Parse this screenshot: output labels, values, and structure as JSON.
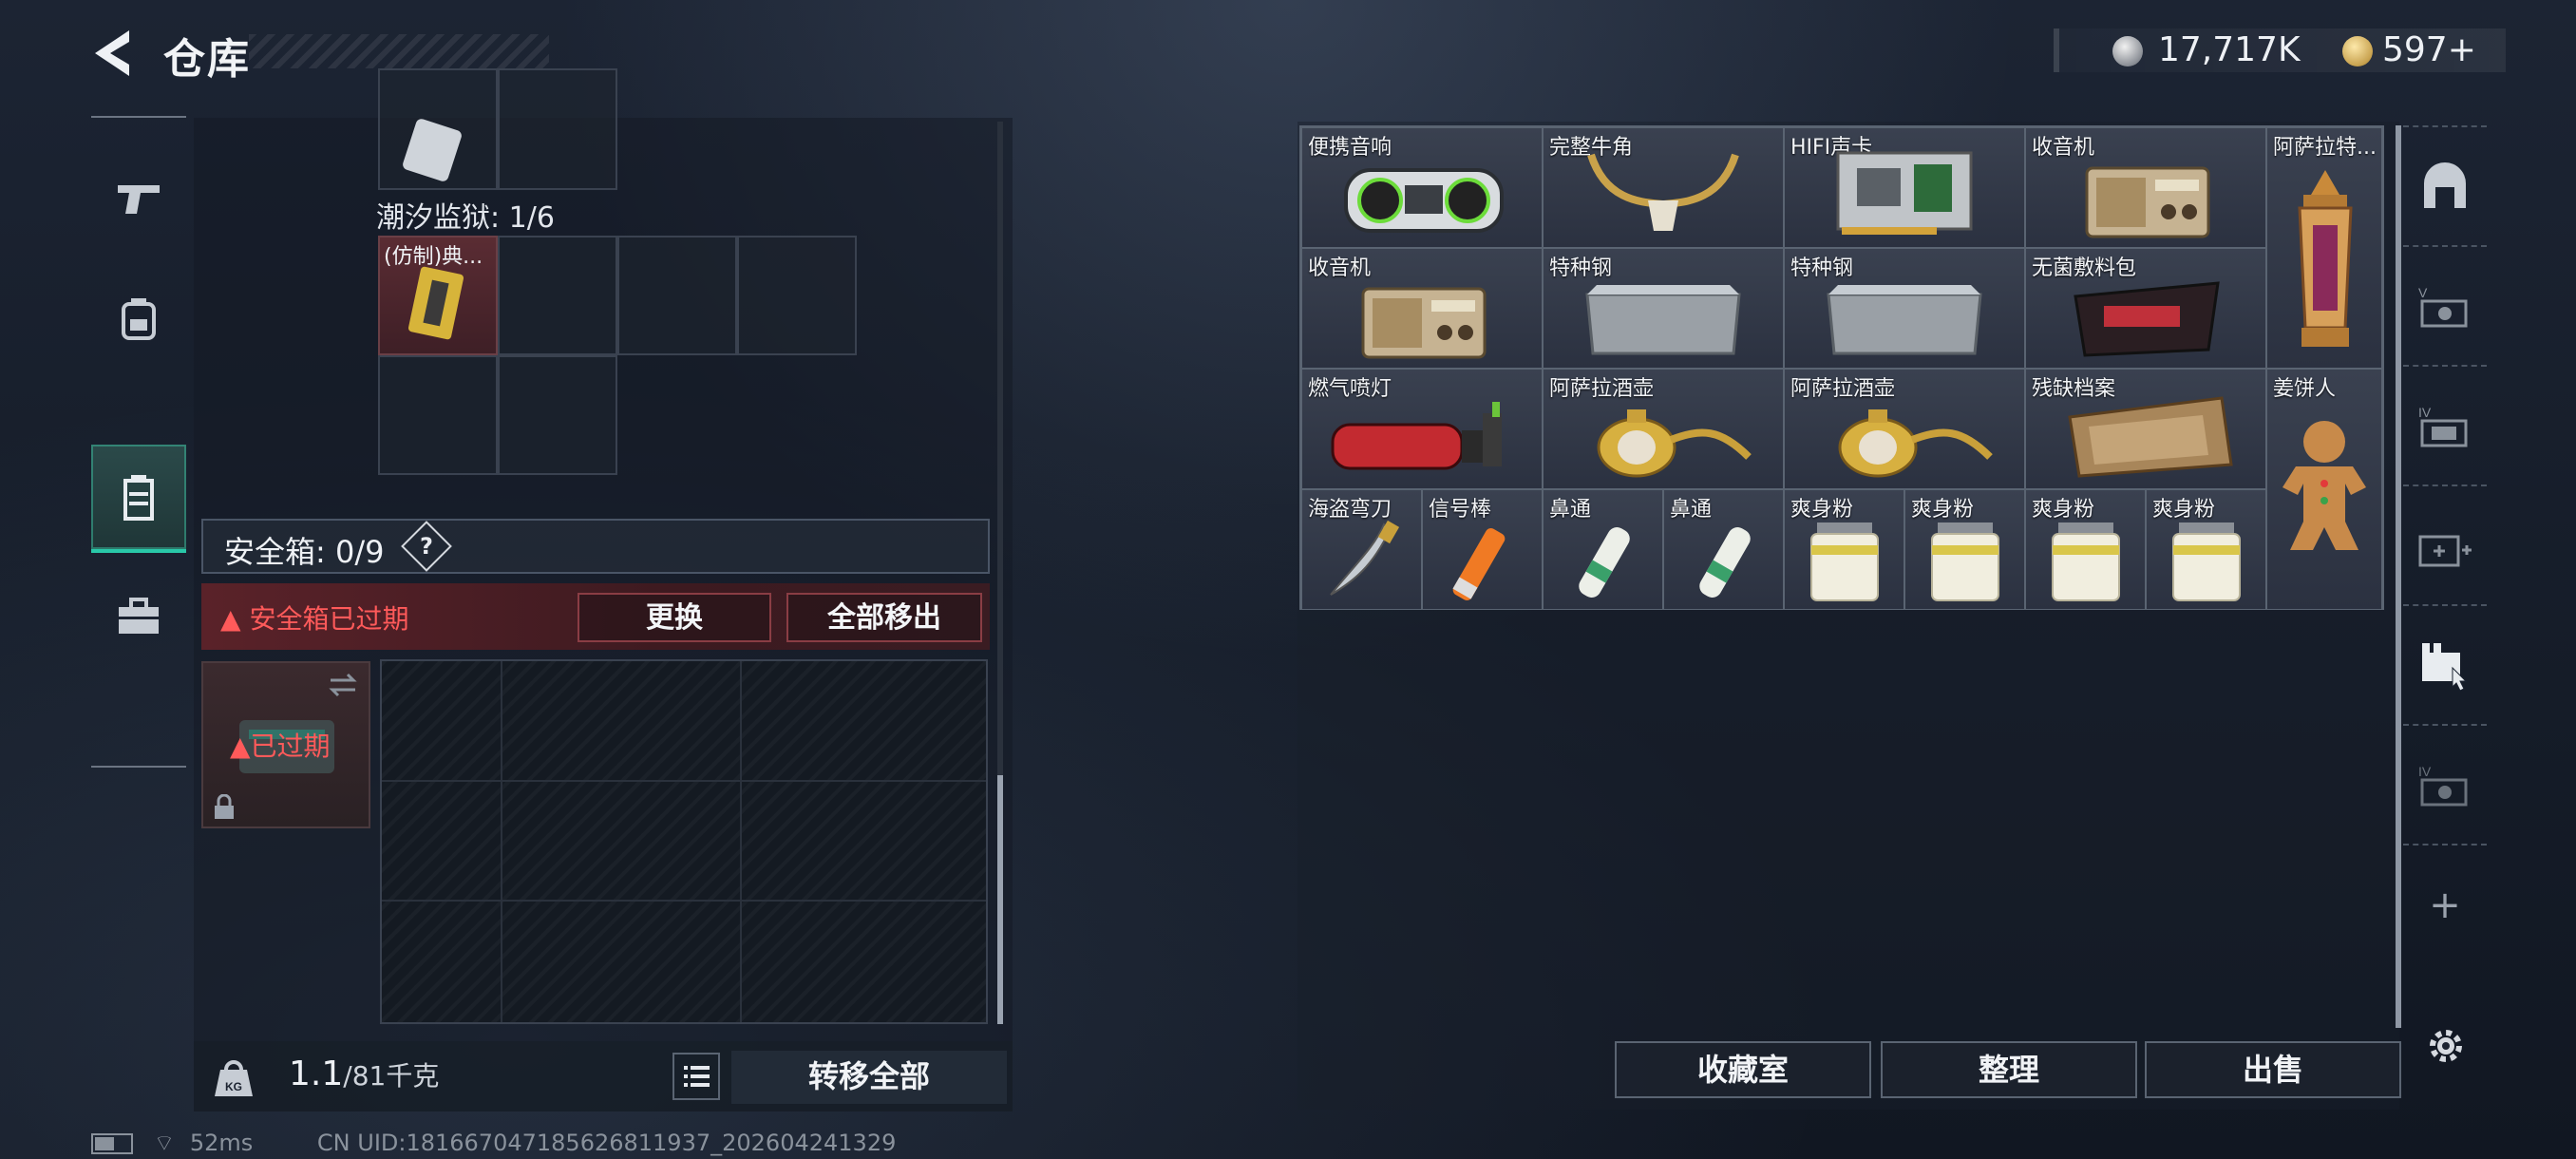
{
  "header": {
    "title": "仓库",
    "silver_amount": "17,717K",
    "gold_amount": "597+"
  },
  "left_rail": {
    "tabs": [
      {
        "name": "gun-icon"
      },
      {
        "name": "backpack-icon"
      },
      {
        "name": "vest-icon",
        "active": true
      },
      {
        "name": "case-icon"
      }
    ]
  },
  "loadout": {
    "container_label": "潮汐监狱: 1/6",
    "item_name": "(仿制)典..."
  },
  "secure_box": {
    "label": "安全箱: 0/9",
    "help": "?",
    "expired_warning": "安全箱已过期",
    "replace_button": "更换",
    "move_all_button": "全部移出",
    "expired_tag": "已过期"
  },
  "weight": {
    "current": "1.1",
    "max": "/81千克",
    "transfer_all": "转移全部"
  },
  "status": {
    "ping": "52ms",
    "uid": "CN UID:181667047185626811937_202604241329"
  },
  "stash": {
    "items": [
      {
        "label": "便携音响"
      },
      {
        "label": "完整牛角"
      },
      {
        "label": "HIFI声卡"
      },
      {
        "label": "收音机"
      },
      {
        "label": "阿萨拉特..."
      },
      {
        "label": "收音机"
      },
      {
        "label": "特种钢"
      },
      {
        "label": "特种钢"
      },
      {
        "label": "无菌敷料包"
      },
      {
        "label": "燃气喷灯"
      },
      {
        "label": "阿萨拉酒壶"
      },
      {
        "label": "阿萨拉酒壶"
      },
      {
        "label": "残缺档案"
      },
      {
        "label": "姜饼人"
      },
      {
        "label": "海盗弯刀"
      },
      {
        "label": "信号棒"
      },
      {
        "label": "鼻通"
      },
      {
        "label": "鼻通"
      },
      {
        "label": "爽身粉"
      },
      {
        "label": "爽身粉"
      },
      {
        "label": "爽身粉"
      },
      {
        "label": "爽身粉"
      }
    ],
    "collection_button": "收藏室",
    "sort_button": "整理",
    "sell_button": "出售"
  },
  "right_rail": {
    "add": "+"
  },
  "colors": {
    "accent": "#29c8a8",
    "warning": "#ff5a5a"
  }
}
